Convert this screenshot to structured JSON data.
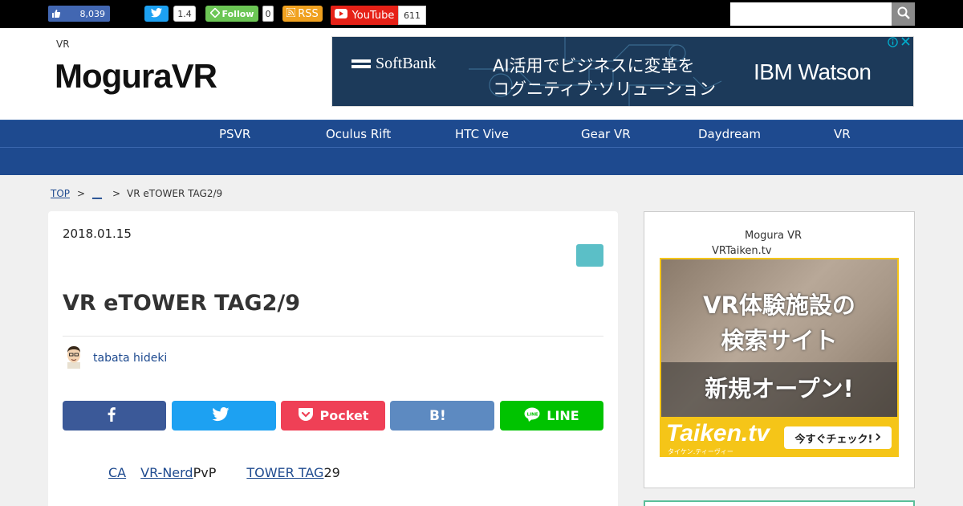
{
  "topbar": {
    "fb_like_count": "8,039",
    "twitter_count": "1.4",
    "follow_label": "Follow",
    "follow_count": "0",
    "rss_label": "RSS",
    "youtube_label": "YouTube",
    "youtube_count": "611",
    "search_placeholder": ""
  },
  "header": {
    "tagline": "VR",
    "logo_text": "MoguraVR",
    "ad": {
      "brand": "SoftBank",
      "line1": "AI活用でビジネスに変革を",
      "line2": "コグニティブ·ソリューション",
      "partner": "IBM Watson"
    }
  },
  "nav": {
    "items": [
      {
        "label": "PSVR"
      },
      {
        "label": "Oculus Rift"
      },
      {
        "label": "HTC Vive"
      },
      {
        "label": "Gear VR"
      },
      {
        "label": "Daydream"
      },
      {
        "label": "VR"
      }
    ]
  },
  "breadcrumb": {
    "top": "TOP",
    "sep": ">",
    "category": "__",
    "current": "VR eTOWER TAG2/9"
  },
  "article": {
    "date": "2018.01.15",
    "title": "VR eTOWER TAG2/9",
    "author": "tabata hideki",
    "share": {
      "facebook": "",
      "twitter": "",
      "pocket": "Pocket",
      "hatena": "",
      "line": "LINE"
    },
    "body": {
      "link1": "CA",
      "link2": "VR-Nerd",
      "text1": "PvP",
      "link3": "TOWER TAG",
      "text2": "29"
    }
  },
  "sidebar": {
    "line1": "Mogura VR",
    "line2": "VRTaiken.tv",
    "ad": {
      "line1": "VR体験施設の",
      "line2": "検索サイト",
      "line3": "新規オープン!",
      "brand": "Taiken.tv",
      "brand_sub": "タイケン.ティーヴィー",
      "cta": "今すぐチェック!"
    }
  }
}
